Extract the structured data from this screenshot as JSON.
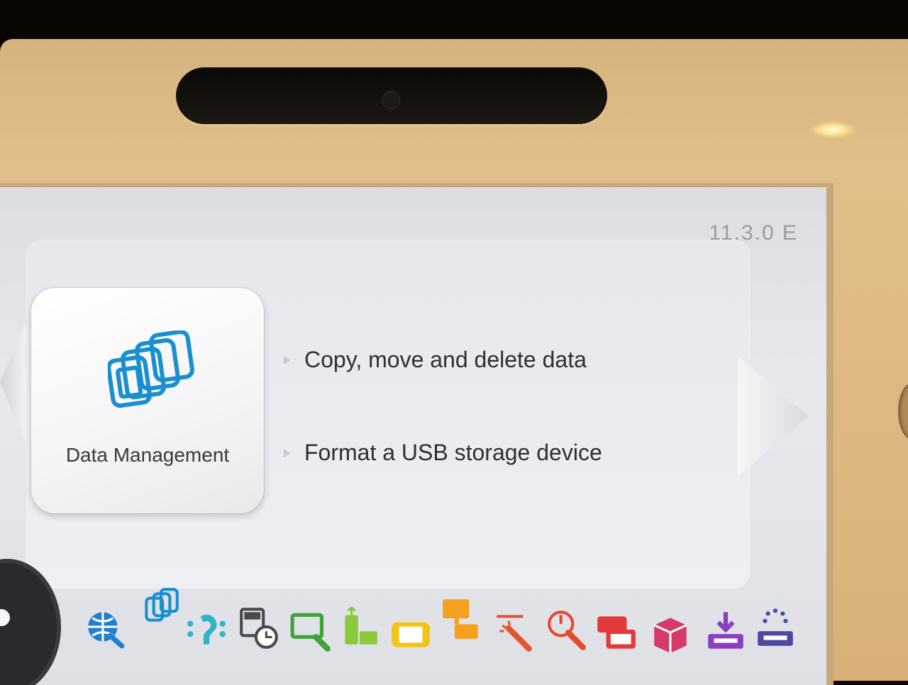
{
  "version_label": "11.3.0 E",
  "selected_category": {
    "label": "Data Management",
    "icon": "stacked-cards-icon",
    "accent_color": "#1a8fd0"
  },
  "menu": {
    "items": [
      {
        "label": "Copy, move and delete data"
      },
      {
        "label": "Format a USB storage device"
      }
    ]
  },
  "category_strip": [
    {
      "icon": "internet-wrench-icon",
      "color": "#1e7fd0"
    },
    {
      "icon": "data-management-icon",
      "color": "#1a8fd0"
    },
    {
      "icon": "accessibility-icon",
      "color": "#2fb3c8"
    },
    {
      "icon": "date-time-icon",
      "color": "#4a4a4a"
    },
    {
      "icon": "screen-settings-icon",
      "color": "#3fa33a"
    },
    {
      "icon": "tv-remote-icon",
      "color": "#8bc83a"
    },
    {
      "icon": "gamepad-icon",
      "color": "#f2c417"
    },
    {
      "icon": "tv-display-icon",
      "color": "#f4a21e"
    },
    {
      "icon": "magic-wand-icon",
      "color": "#e1562c"
    },
    {
      "icon": "power-options-icon",
      "color": "#e64a2e"
    },
    {
      "icon": "console-info-icon",
      "color": "#e23a3a"
    },
    {
      "icon": "system-transfer-icon",
      "color": "#d63a66"
    },
    {
      "icon": "system-update-icon",
      "color": "#8a3fc0"
    },
    {
      "icon": "format-console-icon",
      "color": "#4a4aa0"
    }
  ]
}
